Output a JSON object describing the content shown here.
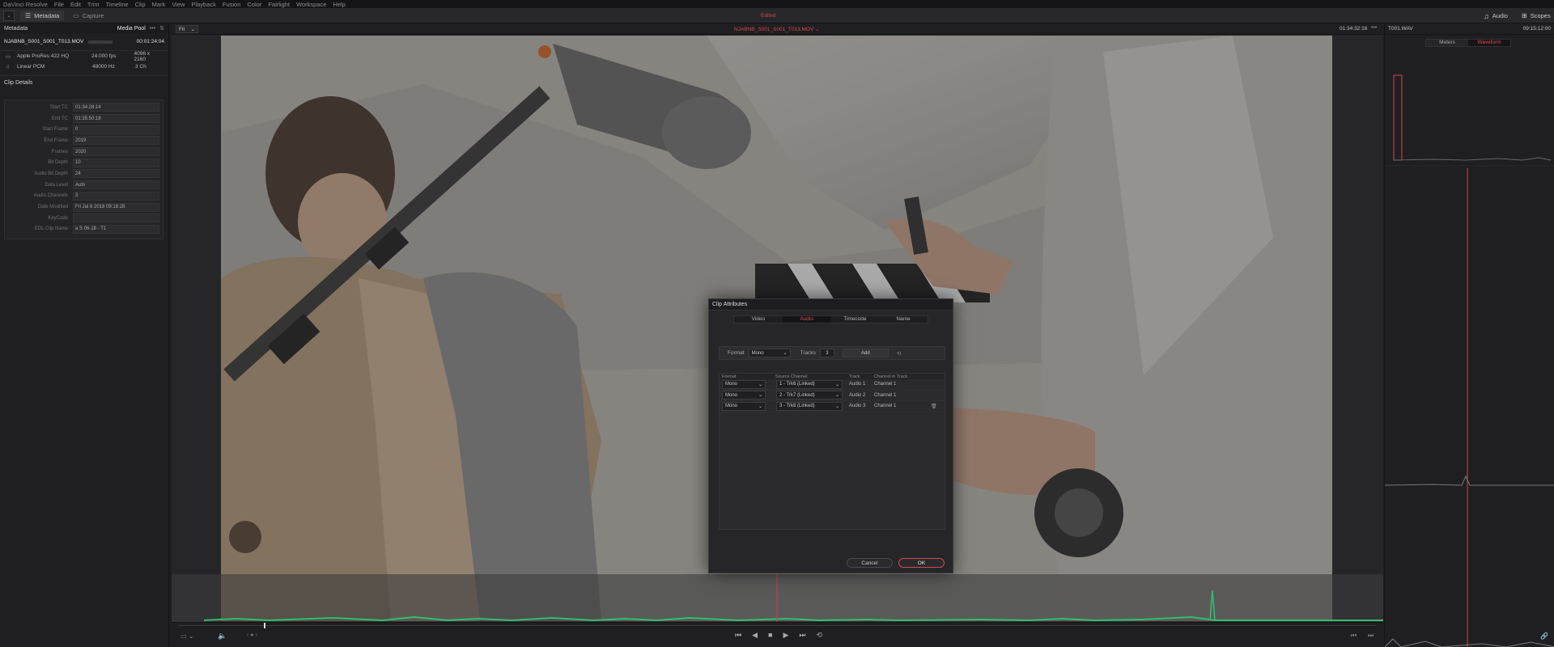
{
  "menu": [
    "DaVinci Resolve",
    "File",
    "Edit",
    "Trim",
    "Timeline",
    "Clip",
    "Mark",
    "View",
    "Playback",
    "Fusion",
    "Color",
    "Fairlight",
    "Workspace",
    "Help"
  ],
  "toolbar": {
    "metadata_label": "Metadata",
    "capture_label": "Capture",
    "center_label": "Edited",
    "audio_label": "Audio",
    "scopes_label": "Scopes"
  },
  "left": {
    "title": "Metadata",
    "media_pool": "Media Pool",
    "clip_name": "NJABNB_S001_S001_T013.MOV",
    "duration": "00:01:24:04",
    "video_codec": "Apple ProRes 422 HQ",
    "fps": "24.000 fps",
    "resolution": "4096 x 2160",
    "audio_codec": "Linear PCM",
    "sample_rate": "48000 Hz",
    "channels": "3 Ch",
    "details_title": "Clip Details",
    "details": [
      {
        "label": "Start TC",
        "value": "01:34:28:14"
      },
      {
        "label": "End TC",
        "value": "01:35:50:18"
      },
      {
        "label": "Start Frame",
        "value": "0"
      },
      {
        "label": "End Frame",
        "value": "2019"
      },
      {
        "label": "Frames",
        "value": "2020"
      },
      {
        "label": "Bit Depth",
        "value": "10"
      },
      {
        "label": "Audio Bit Depth",
        "value": "24"
      },
      {
        "label": "Data Level",
        "value": "Auto"
      },
      {
        "label": "Audio Channels",
        "value": "3"
      },
      {
        "label": "Date Modified",
        "value": "Fri Jul 6 2018 09:16:28"
      },
      {
        "label": "KeyCode",
        "value": ""
      },
      {
        "label": "EDL Clip Name",
        "value": "a S 06-18 - T1"
      }
    ]
  },
  "viewer": {
    "zoom": "Fit",
    "title": "NJABNB_S001_S001_T013.MOV",
    "timecode": "01:34:32:16"
  },
  "right": {
    "file": "T001.WAV",
    "timecode": "09:15:12:00",
    "meters_tab": "Meters",
    "waveform_tab": "Waveform"
  },
  "dialog": {
    "title": "Clip Attributes",
    "tabs": [
      "Video",
      "Audio",
      "Timecode",
      "Name"
    ],
    "format_label": "Format",
    "format_value": "Mono",
    "tracks_label": "Tracks",
    "tracks_value": "3",
    "add_label": "Add",
    "headers": [
      "Format",
      "Source Channel",
      "Track",
      "Channel in Track"
    ],
    "rows": [
      {
        "format": "Mono",
        "source": "1 - Trk6 (Linked)",
        "track": "Audio 1",
        "channel": "Channel 1"
      },
      {
        "format": "Mono",
        "source": "2 - Trk7 (Linked)",
        "track": "Audio 2",
        "channel": "Channel 1"
      },
      {
        "format": "Mono",
        "source": "3 - Trk8 (Linked)",
        "track": "Audio 3",
        "channel": "Channel 1"
      }
    ],
    "cancel": "Cancel",
    "ok": "OK"
  },
  "colors": {
    "accent": "#e04848",
    "waveform": "#2fbf6e"
  }
}
